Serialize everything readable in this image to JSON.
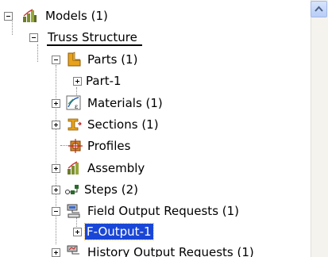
{
  "tree": {
    "models": {
      "label": "Models (1)",
      "icon": "models-icon",
      "state": "expanded"
    },
    "model": {
      "label": "Truss Structure",
      "state": "expanded"
    },
    "parts": {
      "label": "Parts (1)",
      "icon": "parts-icon",
      "state": "expanded"
    },
    "part1": {
      "label": "Part-1",
      "state": "collapsed"
    },
    "materials": {
      "label": "Materials (1)",
      "icon": "materials-icon",
      "state": "collapsed"
    },
    "sections": {
      "label": "Sections (1)",
      "icon": "sections-icon",
      "state": "collapsed"
    },
    "profiles": {
      "label": "Profiles",
      "icon": "profiles-icon"
    },
    "assembly": {
      "label": "Assembly",
      "icon": "assembly-icon",
      "state": "collapsed"
    },
    "steps": {
      "label": "Steps (2)",
      "icon": "steps-icon",
      "state": "collapsed"
    },
    "field_output": {
      "label": "Field Output Requests (1)",
      "icon": "field-output-icon",
      "state": "expanded"
    },
    "f_output1": {
      "label": "F-Output-1",
      "state": "collapsed",
      "selected": true
    },
    "history_output": {
      "label": "History Output Requests (1)",
      "icon": "history-output-icon",
      "state": "collapsed"
    }
  },
  "colors": {
    "selection": "#1a46d6",
    "scrollbar_button": "#c3d5fa"
  }
}
